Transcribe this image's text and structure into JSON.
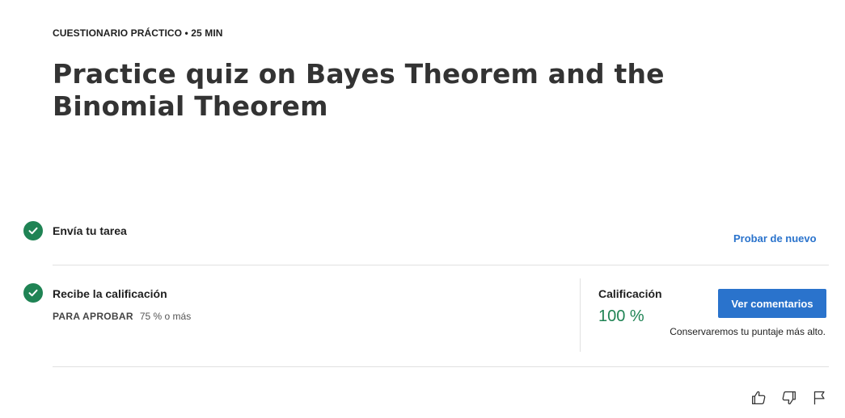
{
  "header": {
    "kicker": "CUESTIONARIO PRÁCTICO • 25 MIN",
    "title": "Practice quiz on Bayes Theorem and the Binomial Theorem"
  },
  "steps": [
    {
      "title": "Envía tu tarea",
      "status_icon": "check-circle-icon",
      "action_label": "Probar de nuevo"
    },
    {
      "title": "Recibe la calificación",
      "status_icon": "check-circle-icon",
      "pass_label": "PARA APROBAR",
      "pass_value": "75 % o más"
    }
  ],
  "grade": {
    "label": "Calificación",
    "value": "100 %",
    "button_label": "Ver comentarios",
    "note": "Conservaremos tu puntaje más alto."
  },
  "feedback": {
    "icons": [
      "thumbs-up-icon",
      "thumbs-down-icon",
      "flag-icon"
    ]
  },
  "colors": {
    "accent": "#2a73cc",
    "success": "#1f8354"
  }
}
